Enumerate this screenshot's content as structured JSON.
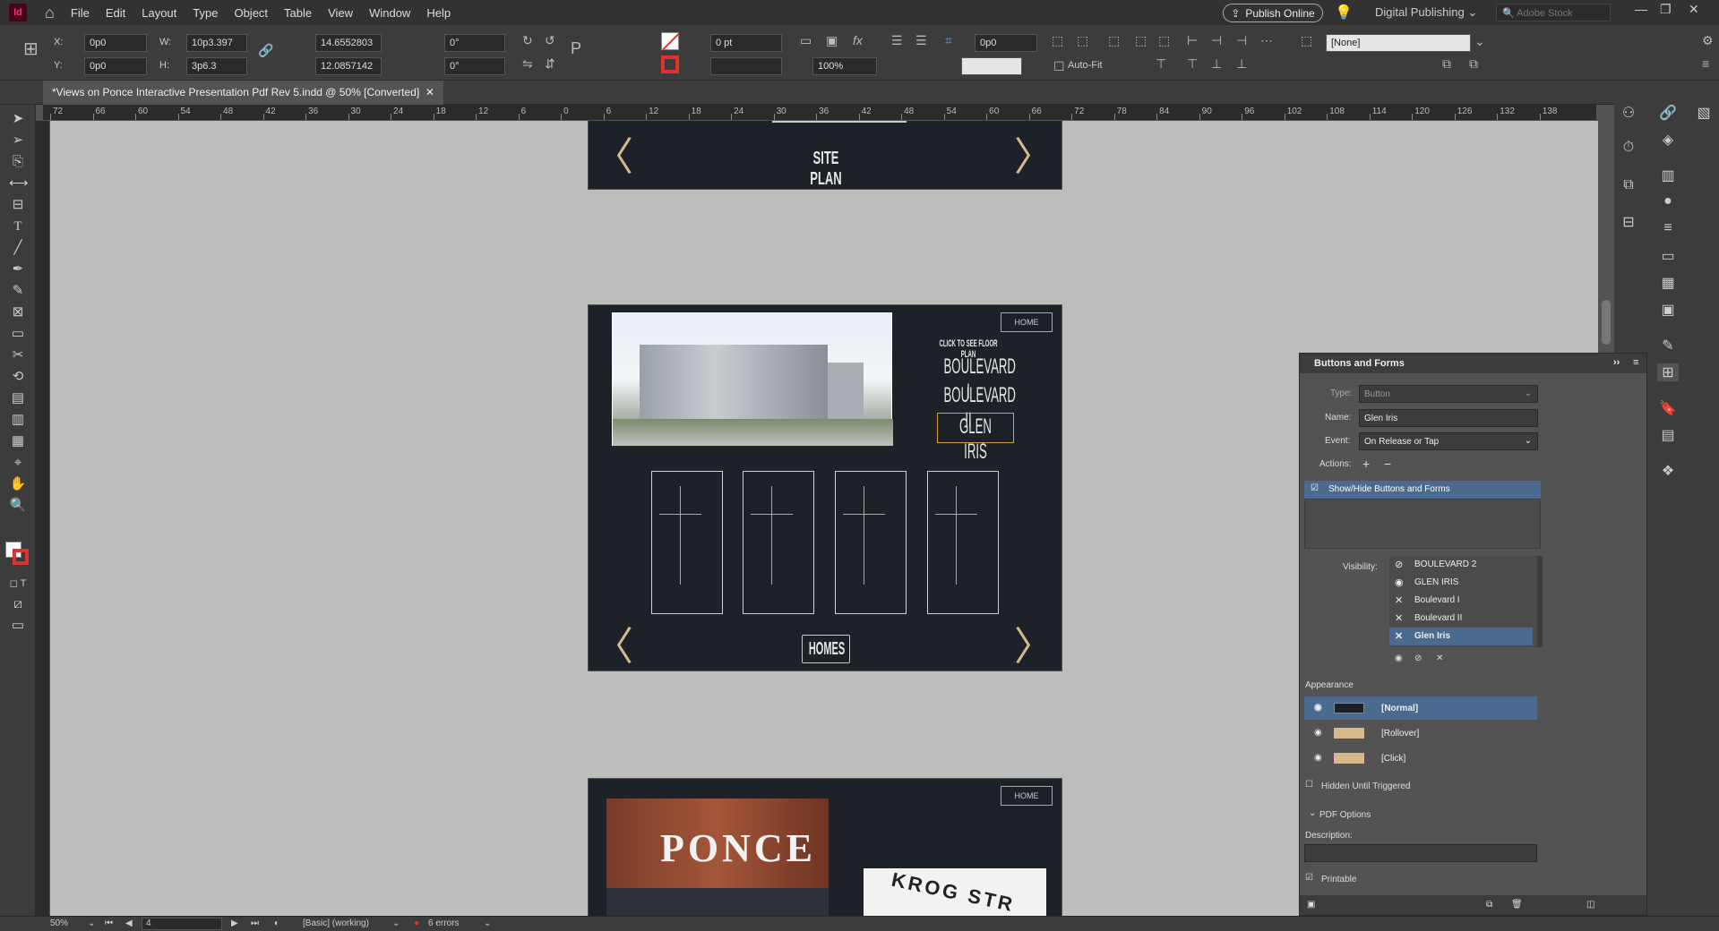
{
  "menubar": {
    "app_icon": "Id",
    "items": [
      "File",
      "Edit",
      "Layout",
      "Type",
      "Object",
      "Table",
      "View",
      "Window",
      "Help"
    ],
    "publish_label": "Publish Online",
    "workspace": "Digital Publishing",
    "stock_placeholder": "Adobe Stock"
  },
  "control": {
    "x_label": "X:",
    "x_value": "0p0",
    "y_label": "Y:",
    "y_value": "0p0",
    "w_label": "W:",
    "w_value": "10p3.397",
    "h_label": "H:",
    "h_value": "3p6.3",
    "scale_x": "14.6552803",
    "scale_y": "12.0857142",
    "angle": "0°",
    "shear": "0°",
    "stroke_weight": "0 pt",
    "opacity": "100%",
    "offset": "0p0",
    "style": "[None]",
    "autofit_label": "Auto-Fit"
  },
  "document": {
    "tab_title": "*Views on Ponce Interactive Presentation Pdf Rev 5.indd @ 50% [Converted]"
  },
  "ruler": {
    "ticks": [
      "72",
      "66",
      "60",
      "54",
      "48",
      "42",
      "36",
      "30",
      "24",
      "18",
      "12",
      "6",
      "0",
      "6",
      "12",
      "18",
      "24",
      "30",
      "36",
      "42",
      "48",
      "54",
      "60",
      "66",
      "72",
      "78",
      "84",
      "90",
      "96",
      "102",
      "108",
      "114",
      "120",
      "126",
      "132",
      "138"
    ]
  },
  "pages": {
    "site_plan_label": "SITE PLAN",
    "homes_label": "HOMES",
    "click_caption": "CLICK TO SEE FLOOR PLAN",
    "buttons": [
      "BOULEVARD I",
      "BOULEVARD II",
      "GLEN IRIS"
    ],
    "logo_text": "HOME",
    "ponce_sign": "PONCE",
    "krog_sign": "KROG STR"
  },
  "panel": {
    "title": "Buttons and Forms",
    "type_label": "Type:",
    "type_value": "Button",
    "name_label": "Name:",
    "name_value": "Glen Iris",
    "event_label": "Event:",
    "event_value": "On Release or Tap",
    "actions_label": "Actions:",
    "action_item": "Show/Hide Buttons and Forms",
    "visibility_label": "Visibility:",
    "visibility_items": [
      "BOULEVARD 2",
      "GLEN IRIS",
      "Boulevard I",
      "Boulevard II",
      "Glen Iris"
    ],
    "appearance_label": "Appearance",
    "appearance_states": [
      "[Normal]",
      "[Rollover]",
      "[Click]"
    ],
    "hidden_label": "Hidden Until Triggered",
    "pdf_options_label": "PDF Options",
    "description_label": "Description:",
    "printable_label": "Printable"
  },
  "status": {
    "zoom": "50%",
    "page": "4",
    "preflight_profile": "[Basic] (working)",
    "errors": "6 errors"
  },
  "colors": {
    "spread_bg": "#1d2228",
    "accent_gold": "#d7b98e",
    "selection_blue": "#4a6a8f",
    "error_red": "#e03030"
  }
}
